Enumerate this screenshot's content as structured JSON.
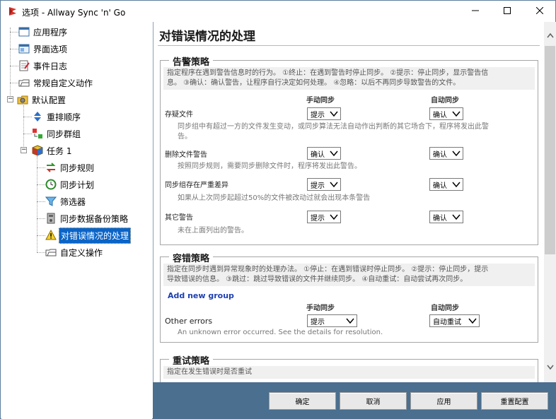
{
  "window": {
    "title": "选项 - Allway Sync 'n' Go"
  },
  "tree": {
    "items": [
      {
        "label": "应用程序",
        "icon": "app-window-icon"
      },
      {
        "label": "界面选项",
        "icon": "ui-window-icon"
      },
      {
        "label": "事件日志",
        "icon": "log-icon"
      },
      {
        "label": "常规自定义动作",
        "icon": "folder-action-icon"
      },
      {
        "label": "默认配置",
        "icon": "gear-folder-icon"
      },
      {
        "label": "重排顺序",
        "icon": "up-down-arrows-icon"
      },
      {
        "label": "同步群组",
        "icon": "sync-group-icon"
      },
      {
        "label": "任务 1",
        "icon": "cube-icon"
      },
      {
        "label": "同步规则",
        "icon": "sync-rules-icon"
      },
      {
        "label": "同步计划",
        "icon": "clock-icon"
      },
      {
        "label": "筛选器",
        "icon": "filter-icon"
      },
      {
        "label": "同步数据备份策略",
        "icon": "backup-icon"
      },
      {
        "label": "对错误情况的处理",
        "icon": "warning-icon"
      },
      {
        "label": "自定义操作",
        "icon": "folder-action-icon"
      }
    ]
  },
  "main": {
    "title": "对错误情况的处理",
    "warning_group": {
      "title": "告警策略",
      "desc_line1": "指定程序在遇到警告信息时的行为。 ①终止：在遇到警告时停止同步。 ②提示：停止同步，显示警告信",
      "desc_line2": "息。 ③确认：确认警告，让程序自行决定如何处理。 ④忽略：以后不再同步导致警告的文件。",
      "col_manual": "手动同步",
      "col_auto": "自动同步",
      "rows": [
        {
          "label": "存疑文件",
          "desc1": "同步组中有超过一方的文件发生变动，或同步算法无法自动作出判断的其它场合下，程序将发出此警",
          "desc2": "告。",
          "manual": "提示",
          "auto": "确认"
        },
        {
          "label": "删除文件警告",
          "desc1": "按照同步规则，需要同步删除文件时，程序将发出此警告。",
          "desc2": "",
          "manual": "确认",
          "auto": "确认"
        },
        {
          "label": "同步组存在严重差异",
          "desc1": "如果从上次同步起超过50%的文件被改动过就会出现本条警告",
          "desc2": "",
          "manual": "提示",
          "auto": "确认"
        },
        {
          "label": "其它警告",
          "desc1": "未在上面列出的警告。",
          "desc2": "",
          "manual": "提示",
          "auto": "确认"
        }
      ]
    },
    "error_group": {
      "title": "容错策略",
      "desc_line1": "指定在同步时遇到异常现象时的处理办法。 ①停止：在遇到错误时停止同步。 ②提示：停止同步，提示",
      "desc_line2": "导致错误的信息。 ③跳过：跳过导致错误的文件并继续同步。 ④自动重试：自动尝试再次同步。",
      "add_group": "Add new group",
      "col_manual": "手动同步",
      "col_auto": "自动同步",
      "row_label": "Other errors",
      "row_desc": "An unknown error occurred. See the details for resolution.",
      "manual": "提示",
      "auto": "自动重试"
    },
    "retry_group": {
      "title": "重试策略",
      "desc_line1": "指定在发生错误时是否重试"
    }
  },
  "buttons": {
    "ok": "确定",
    "cancel": "取消",
    "apply": "应用",
    "reset": "重置配置"
  }
}
